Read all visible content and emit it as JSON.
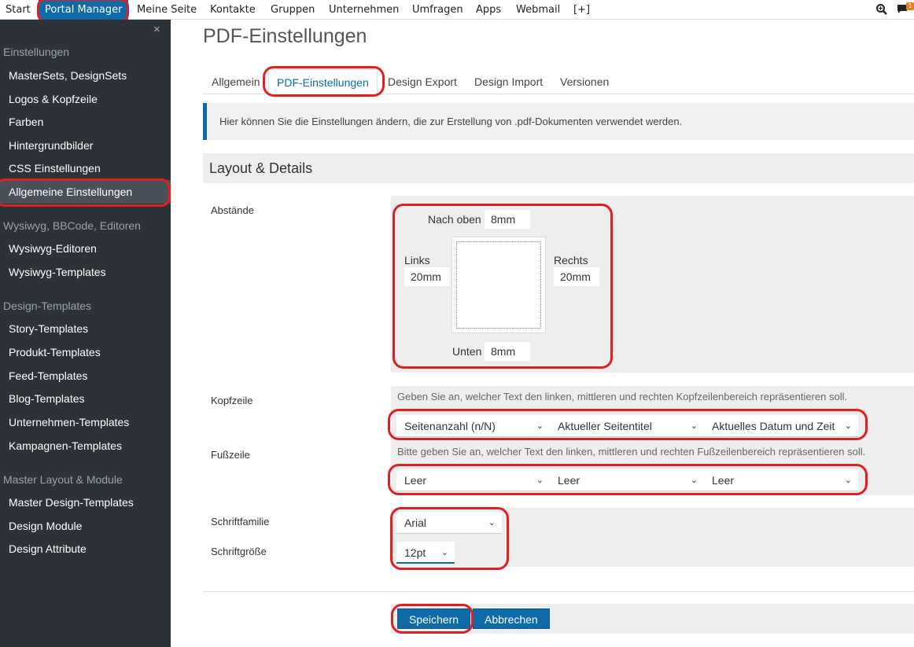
{
  "topnav": {
    "items": [
      "Start",
      "Portal Manager",
      "Meine Seite",
      "Kontakte",
      "Gruppen",
      "Unternehmen",
      "Umfragen",
      "Apps",
      "Webmail",
      "[+]"
    ],
    "badge": "1",
    "icons": [
      "search-icon",
      "chat-icon"
    ]
  },
  "sidebar": {
    "close": "×",
    "sections": [
      {
        "heading": "Einstellungen",
        "items": [
          "MasterSets, DesignSets",
          "Logos & Kopfzeile",
          "Farben",
          "Hintergrundbilder",
          "CSS Einstellungen",
          "Allgemeine Einstellungen"
        ]
      },
      {
        "heading": "Wysiwyg, BBCode, Editoren",
        "items": [
          "Wysiwyg-Editoren",
          "Wysiwyg-Templates"
        ]
      },
      {
        "heading": "Design-Templates",
        "items": [
          "Story-Templates",
          "Produkt-Templates",
          "Feed-Templates",
          "Blog-Templates",
          "Unternehmen-Templates",
          "Kampagnen-Templates"
        ]
      },
      {
        "heading": "Master Layout & Module",
        "items": [
          "Master Design-Templates",
          "Design Module",
          "Design Attribute"
        ]
      }
    ],
    "active_item": "Allgemeine Einstellungen"
  },
  "main": {
    "title": "PDF-Einstellungen",
    "tabs": [
      "Allgemein",
      "PDF-Einstellungen",
      "Design Export",
      "Design Import",
      "Versionen"
    ],
    "active_tab": "PDF-Einstellungen",
    "info": "Hier können Sie die Einstellungen ändern, die zur Erstellung von .pdf-Dokumenten verwendet werden.",
    "section_title": "Layout & Details",
    "margins": {
      "label": "Abstände",
      "top_label": "Nach oben",
      "top_value": "8mm",
      "left_label": "Links",
      "left_value": "20mm",
      "right_label": "Rechts",
      "right_value": "20mm",
      "bottom_label": "Unten",
      "bottom_value": "8mm"
    },
    "header": {
      "label": "Kopfzeile",
      "hint": "Geben Sie an, welcher Text den linken, mittleren und rechten Kopfzeilenbereich repräsentieren soll.",
      "selects": [
        "Seitenanzahl (n/N)",
        "Aktueller Seitentitel",
        "Aktuelles Datum und Zeit"
      ]
    },
    "footer": {
      "label": "Fußzeile",
      "hint": "Bitte geben Sie an, welcher Text den linken, mittleren und rechten Fußzeilenbereich repräsentieren soll.",
      "selects": [
        "Leer",
        "Leer",
        "Leer"
      ]
    },
    "font_family": {
      "label": "Schriftfamilie",
      "value": "Arial"
    },
    "font_size": {
      "label": "Schriftgröße",
      "value": "12pt"
    },
    "buttons": {
      "save": "Speichern",
      "cancel": "Abbrechen"
    }
  },
  "colors": {
    "accent": "#0e6ba8",
    "sidebar_bg": "#2d3238",
    "highlight": "#e02020"
  }
}
